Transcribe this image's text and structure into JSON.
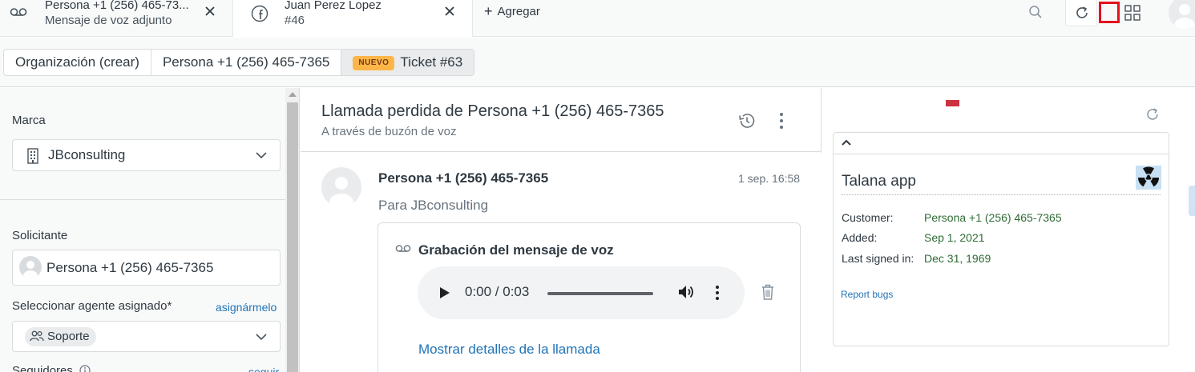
{
  "tabs": [
    {
      "title": "Persona +1 (256) 465-73...",
      "subtitle": "Mensaje de voz adjunto",
      "icon": "voicemail-icon"
    },
    {
      "title": "Juan Perez Lopez",
      "subtitle": "#46",
      "icon": "facebook-icon"
    }
  ],
  "add_tab_label": "Agregar",
  "breadcrumbs": {
    "org": "Organización (crear)",
    "person": "Persona +1 (256) 465-7365",
    "badge": "NUEVO",
    "ticket": "Ticket #63"
  },
  "left": {
    "brand_label": "Marca",
    "brand_value": "JBconsulting",
    "requester_label": "Solicitante",
    "requester_value": "Persona +1 (256) 465-7365",
    "assignee_label": "Seleccionar agente asignado*",
    "assign_me": "asignármelo",
    "assignee_value": "Soporte",
    "followers_label": "Seguidores",
    "follow_link": "seguir"
  },
  "conversation": {
    "title": "Llamada perdida de Persona +1 (256) 465-7365",
    "subtitle": "A través de buzón de voz",
    "sender": "Persona +1 (256) 465-7365",
    "timestamp": "1 sep. 16:58",
    "to_line": "Para JBconsulting",
    "recording_title": "Grabación del mensaje de voz",
    "player_time": "0:00 / 0:03",
    "call_details_link": "Mostrar detalles de la llamada"
  },
  "app": {
    "title": "Talana app",
    "fields": [
      {
        "key": "Customer:",
        "value": "Persona +1 (256) 465-7365"
      },
      {
        "key": "Added:",
        "value": "Sep 1, 2021"
      },
      {
        "key": "Last signed in:",
        "value": "Dec 31, 1969"
      }
    ],
    "report_link": "Report bugs"
  },
  "colors": {
    "accent_link": "#1f73b7",
    "badge_new": "#ffb648",
    "highlight": "#e3121d",
    "value_green": "#2f6b35"
  }
}
